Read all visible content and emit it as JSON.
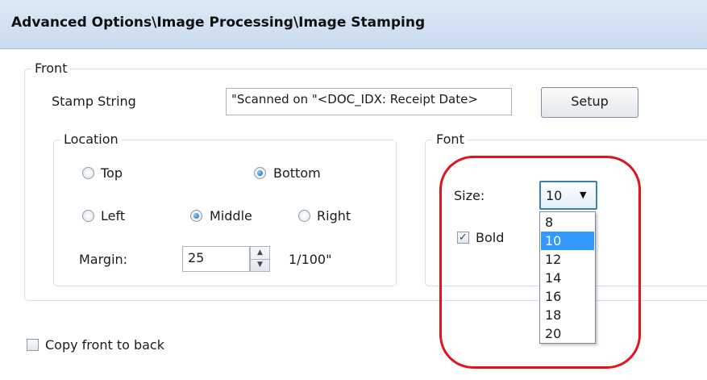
{
  "header": {
    "title": "Advanced Options\\Image Processing\\Image Stamping"
  },
  "front": {
    "legend": "Front",
    "stamp_label": "Stamp String",
    "stamp_value": "\"Scanned on \"<DOC_IDX: Receipt Date>",
    "setup_label": "Setup"
  },
  "location": {
    "legend": "Location",
    "top_label": "Top",
    "bottom_label": "Bottom",
    "left_label": "Left",
    "middle_label": "Middle",
    "right_label": "Right",
    "vertical_selected": "Bottom",
    "horizontal_selected": "Middle",
    "margin_label": "Margin:",
    "margin_value": "25",
    "margin_unit": "1/100\""
  },
  "font": {
    "legend": "Font",
    "size_label": "Size:",
    "size_value": "10",
    "bold_label": "Bold",
    "bold_checked": true,
    "size_options": [
      "8",
      "10",
      "12",
      "14",
      "16",
      "18",
      "20"
    ],
    "highlighted_option": "10"
  },
  "copy_label": "Copy front to back",
  "copy_checked": false,
  "colors": {
    "header_bg": "#d3e2f3",
    "selection": "#3399ff",
    "annotation": "#e0141e"
  }
}
